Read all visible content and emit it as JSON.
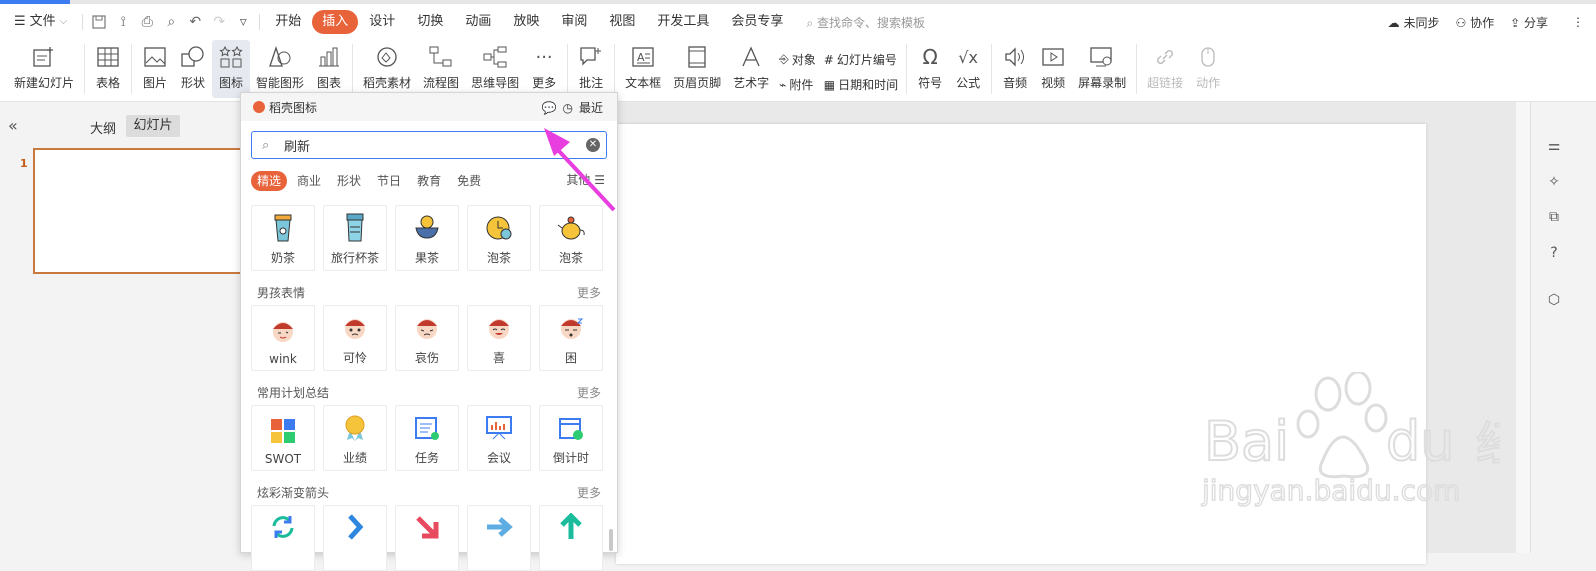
{
  "menubar": {
    "file_label": "文件",
    "tabs": [
      "开始",
      "插入",
      "设计",
      "切换",
      "动画",
      "放映",
      "审阅",
      "视图",
      "开发工具",
      "会员专享"
    ],
    "active_tab": "插入",
    "search_placeholder": "查找命令、搜索模板",
    "sync_label": "未同步",
    "collab_label": "协作",
    "share_label": "分享"
  },
  "ribbon": {
    "new_slide": "新建幻灯片",
    "table": "表格",
    "picture": "图片",
    "shape": "形状",
    "icon": "图标",
    "smart_shape": "智能图形",
    "chart": "图表",
    "material": "稻壳素材",
    "flowchart": "流程图",
    "mindmap": "思维导图",
    "more": "更多",
    "comment": "批注",
    "textbox": "文本框",
    "header_footer": "页眉页脚",
    "wordart": "艺术字",
    "object": "对象",
    "attachment": "附件",
    "slide_number": "幻灯片编号",
    "datetime": "日期和时间",
    "symbol": "符号",
    "formula": "公式",
    "audio": "音频",
    "video": "视频",
    "screen_record": "屏幕录制",
    "hyperlink": "超链接",
    "action": "动作"
  },
  "leftpane": {
    "outline_tab": "大纲",
    "slides_tab": "幻灯片",
    "slide_number": "1"
  },
  "panel": {
    "title": "稻壳图标",
    "recent": "最近",
    "search_value": "刷新",
    "categories": [
      "精选",
      "商业",
      "形状",
      "节日",
      "教育",
      "免费"
    ],
    "other": "其他",
    "row1": [
      "奶茶",
      "旅行杯茶",
      "果茶",
      "泡茶",
      "泡茶"
    ],
    "section2_title": "男孩表情",
    "section2_more": "更多",
    "row2": [
      "wink",
      "可怜",
      "哀伤",
      "喜",
      "困"
    ],
    "section3_title": "常用计划总结",
    "section3_more": "更多",
    "row3": [
      "SWOT",
      "业绩",
      "任务",
      "会议",
      "倒计时"
    ],
    "section4_title": "炫彩渐变箭头",
    "section4_more": "更多"
  },
  "watermark": {
    "brand": "Bai",
    "brand2": "du",
    "cn": "经验",
    "url": "jingyan.baidu.com"
  },
  "colors": {
    "accent": "#e8623a",
    "blue": "#3c7cf0",
    "annotation_arrow": "#e83ee0"
  }
}
